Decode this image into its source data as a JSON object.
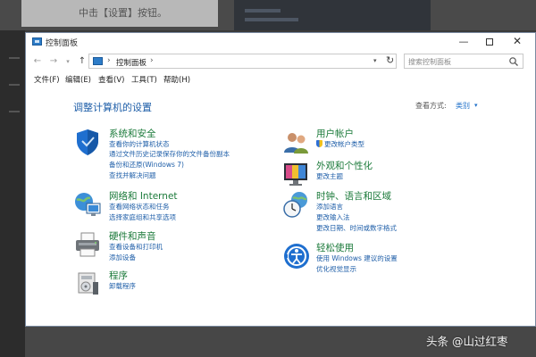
{
  "background": {
    "top_text": "中击【设置】按钮。"
  },
  "window": {
    "title": "控制面板",
    "minimize": "—",
    "close": "✕"
  },
  "address": {
    "path": "控制面板",
    "separator": "›",
    "search_placeholder": "搜索控制面板"
  },
  "menu": [
    "文件(F)",
    "编辑(E)",
    "查看(V)",
    "工具(T)",
    "帮助(H)"
  ],
  "main": {
    "title": "调整计算机的设置",
    "view_by_label": "查看方式:",
    "view_by_value": "类别"
  },
  "categories": {
    "system_security": {
      "title": "系统和安全",
      "links": [
        "查看你的计算机状态",
        "通过文件历史记录保存你的文件备份副本",
        "备份和还原(Windows 7)",
        "查找并解决问题"
      ]
    },
    "network": {
      "title": "网络和 Internet",
      "links": [
        "查看网络状态和任务",
        "选择家庭组和共享选项"
      ]
    },
    "hardware": {
      "title": "硬件和声音",
      "links": [
        "查看设备和打印机",
        "添加设备"
      ]
    },
    "programs": {
      "title": "程序",
      "links": [
        "卸载程序"
      ]
    },
    "user_accounts": {
      "title": "用户帐户",
      "links": [
        "更改帐户类型"
      ]
    },
    "appearance": {
      "title": "外观和个性化",
      "links": [
        "更改主题"
      ]
    },
    "clock_region": {
      "title": "时钟、语言和区域",
      "links": [
        "添加语言",
        "更改输入法",
        "更改日期、时间或数字格式"
      ]
    },
    "ease": {
      "title": "轻松使用",
      "links": [
        "使用 Windows 建议的设置",
        "优化视觉显示"
      ]
    }
  },
  "watermark": "头条 @山过红枣",
  "colors": {
    "link": "#1e5ea8",
    "category_title": "#1b7a3a",
    "accent": "#2d7cc8"
  }
}
